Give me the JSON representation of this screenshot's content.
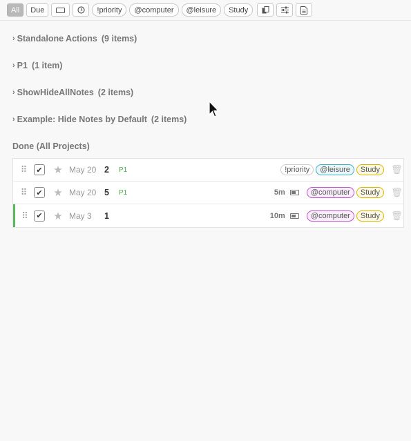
{
  "toolbar": {
    "all": "All",
    "due": "Due",
    "priority": "!priority",
    "computer": "@computer",
    "leisure": "@leisure",
    "study": "Study"
  },
  "sections": [
    {
      "name": "Standalone Actions",
      "count": "(9 items)"
    },
    {
      "name": "P1",
      "count": "(1 item)"
    },
    {
      "name": "ShowHideAllNotes",
      "count": "(2 items)"
    },
    {
      "name": "Example: Hide Notes by Default",
      "count": "(2 items)"
    }
  ],
  "done": {
    "heading": "Done (All Projects)"
  },
  "tasks": [
    {
      "date": "May 20",
      "title": "2",
      "priority": "P1",
      "tags": [
        "!priority",
        "@leisure",
        "Study"
      ]
    },
    {
      "date": "May 20",
      "title": "5",
      "priority": "P1",
      "duration": "5m",
      "tags": [
        "@computer",
        "Study"
      ]
    },
    {
      "date": "May 3",
      "title": "1",
      "duration": "10m",
      "tags": [
        "@computer",
        "Study"
      ]
    }
  ],
  "icons": {
    "grip": "drag-handle-icon",
    "check": "checkmark-icon",
    "star": "star-icon",
    "trash": "trash-icon",
    "battery": "energy-battery-icon"
  },
  "colors": {
    "done_accent": "#5cb85c",
    "priority_green": "#4ab04a",
    "tag_leisure": "#3bb0c9",
    "tag_computer": "#c150d0",
    "tag_study": "#d8b400"
  }
}
